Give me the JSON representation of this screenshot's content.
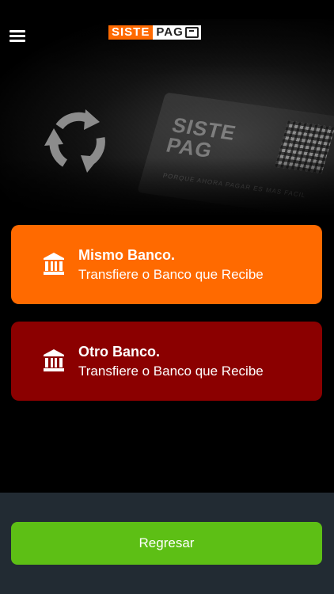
{
  "header": {
    "menu_icon": "hamburger-icon",
    "logo": {
      "left_text": "SISTE",
      "right_text": "PAG",
      "card_icon": "card-icon",
      "accent": "#ff6a00"
    }
  },
  "hero": {
    "icon": "sync-arrows-icon",
    "background_card": {
      "logo_line1": "SISTE",
      "logo_line2": "PAG",
      "small_text": "PORQUE AHORA PAGAR ES MAS FACIL"
    }
  },
  "options": [
    {
      "title": "Mismo Banco.",
      "subtitle": "Transfiere o Banco que Recibe",
      "icon": "bank-icon",
      "color": "#ff6a00"
    },
    {
      "title": "Otro Banco.",
      "subtitle": "Transfiere o Banco que Recibe",
      "icon": "bank-icon",
      "color": "#8b0000"
    }
  ],
  "footer": {
    "back_label": "Regresar",
    "button_color": "#5dbf15",
    "background": "#222b33"
  }
}
